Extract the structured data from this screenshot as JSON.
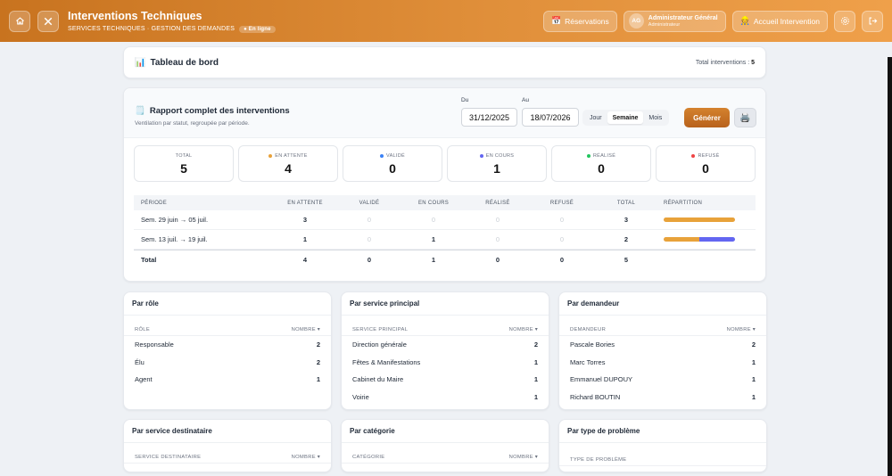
{
  "header": {
    "title": "Interventions Techniques",
    "subtitle": "SERVICES TECHNIQUES · GESTION DES DEMANDES",
    "online": "● En ligne",
    "reservations_label": "Réservations",
    "user_initials": "AG",
    "user_name": "Administrateur Général",
    "user_role": "Administrateur",
    "home_label": "Accueil Intervention"
  },
  "dashboard": {
    "title": "Tableau de bord",
    "total_label": "Total interventions :",
    "total_value": "5"
  },
  "report": {
    "title": "Rapport complet des interventions",
    "subtitle": "Ventilation par statut, regroupée par période.",
    "from_label": "Du",
    "from_value": "31/12/2025",
    "to_label": "Au",
    "to_value": "18/07/2026",
    "periods": [
      "Jour",
      "Semaine",
      "Mois"
    ],
    "generate_label": "Générer",
    "stats": [
      {
        "label": "TOTAL",
        "value": "5",
        "color": ""
      },
      {
        "label": "EN ATTENTE",
        "value": "4",
        "color": "#e8a23a"
      },
      {
        "label": "VALIDÉ",
        "value": "0",
        "color": "#3b82f6"
      },
      {
        "label": "EN COURS",
        "value": "1",
        "color": "#6366f1"
      },
      {
        "label": "RÉALISÉ",
        "value": "0",
        "color": "#22c55e"
      },
      {
        "label": "REFUSÉ",
        "value": "0",
        "color": "#ef4444"
      }
    ],
    "table_headers": [
      "PÉRIODE",
      "EN ATTENTE",
      "VALIDÉ",
      "EN COURS",
      "RÉALISÉ",
      "REFUSÉ",
      "TOTAL",
      "RÉPARTITION"
    ],
    "rows": [
      {
        "period": "Sem. 29 juin → 05 juil.",
        "values": [
          "3",
          "0",
          "0",
          "0",
          "0",
          "3"
        ],
        "attente": 3,
        "encours": 0
      },
      {
        "period": "Sem. 13 juil. → 19 juil.",
        "values": [
          "1",
          "0",
          "1",
          "0",
          "0",
          "2"
        ],
        "attente": 1,
        "encours": 1
      }
    ],
    "total_row": {
      "label": "Total",
      "values": [
        "4",
        "0",
        "1",
        "0",
        "0",
        "5"
      ]
    },
    "colors": {
      "attente": "#e8a23a",
      "encours": "#6366f1"
    }
  },
  "by_role": {
    "title": "Par rôle",
    "col1": "RÔLE",
    "col2": "NOMBRE ▾",
    "rows": [
      {
        "k": "Responsable",
        "v": "2"
      },
      {
        "k": "Élu",
        "v": "2"
      },
      {
        "k": "Agent",
        "v": "1"
      }
    ]
  },
  "by_service": {
    "title": "Par service principal",
    "col1": "SERVICE PRINCIPAL",
    "col2": "NOMBRE ▾",
    "rows": [
      {
        "k": "Direction générale",
        "v": "2"
      },
      {
        "k": "Fêtes & Manifestations",
        "v": "1"
      },
      {
        "k": "Cabinet du Maire",
        "v": "1"
      },
      {
        "k": "Voirie",
        "v": "1"
      }
    ]
  },
  "by_requester": {
    "title": "Par demandeur",
    "col1": "DEMANDEUR",
    "col2": "NOMBRE ▾",
    "rows": [
      {
        "k": "Pascale Bories",
        "v": "2"
      },
      {
        "k": "Marc Torres",
        "v": "1"
      },
      {
        "k": "Emmanuel DUPOUY",
        "v": "1"
      },
      {
        "k": "Richard BOUTIN",
        "v": "1"
      }
    ]
  },
  "by_dest": {
    "title": "Par service destinataire",
    "col1": "SERVICE DESTINATAIRE",
    "col2": "NOMBRE ▾"
  },
  "by_cat": {
    "title": "Par catégorie",
    "col1": "CATÉGORIE",
    "col2": "NOMBRE ▾"
  },
  "by_type": {
    "title": "Par type de problème",
    "col1": "TYPE DE PROBLÈME"
  }
}
